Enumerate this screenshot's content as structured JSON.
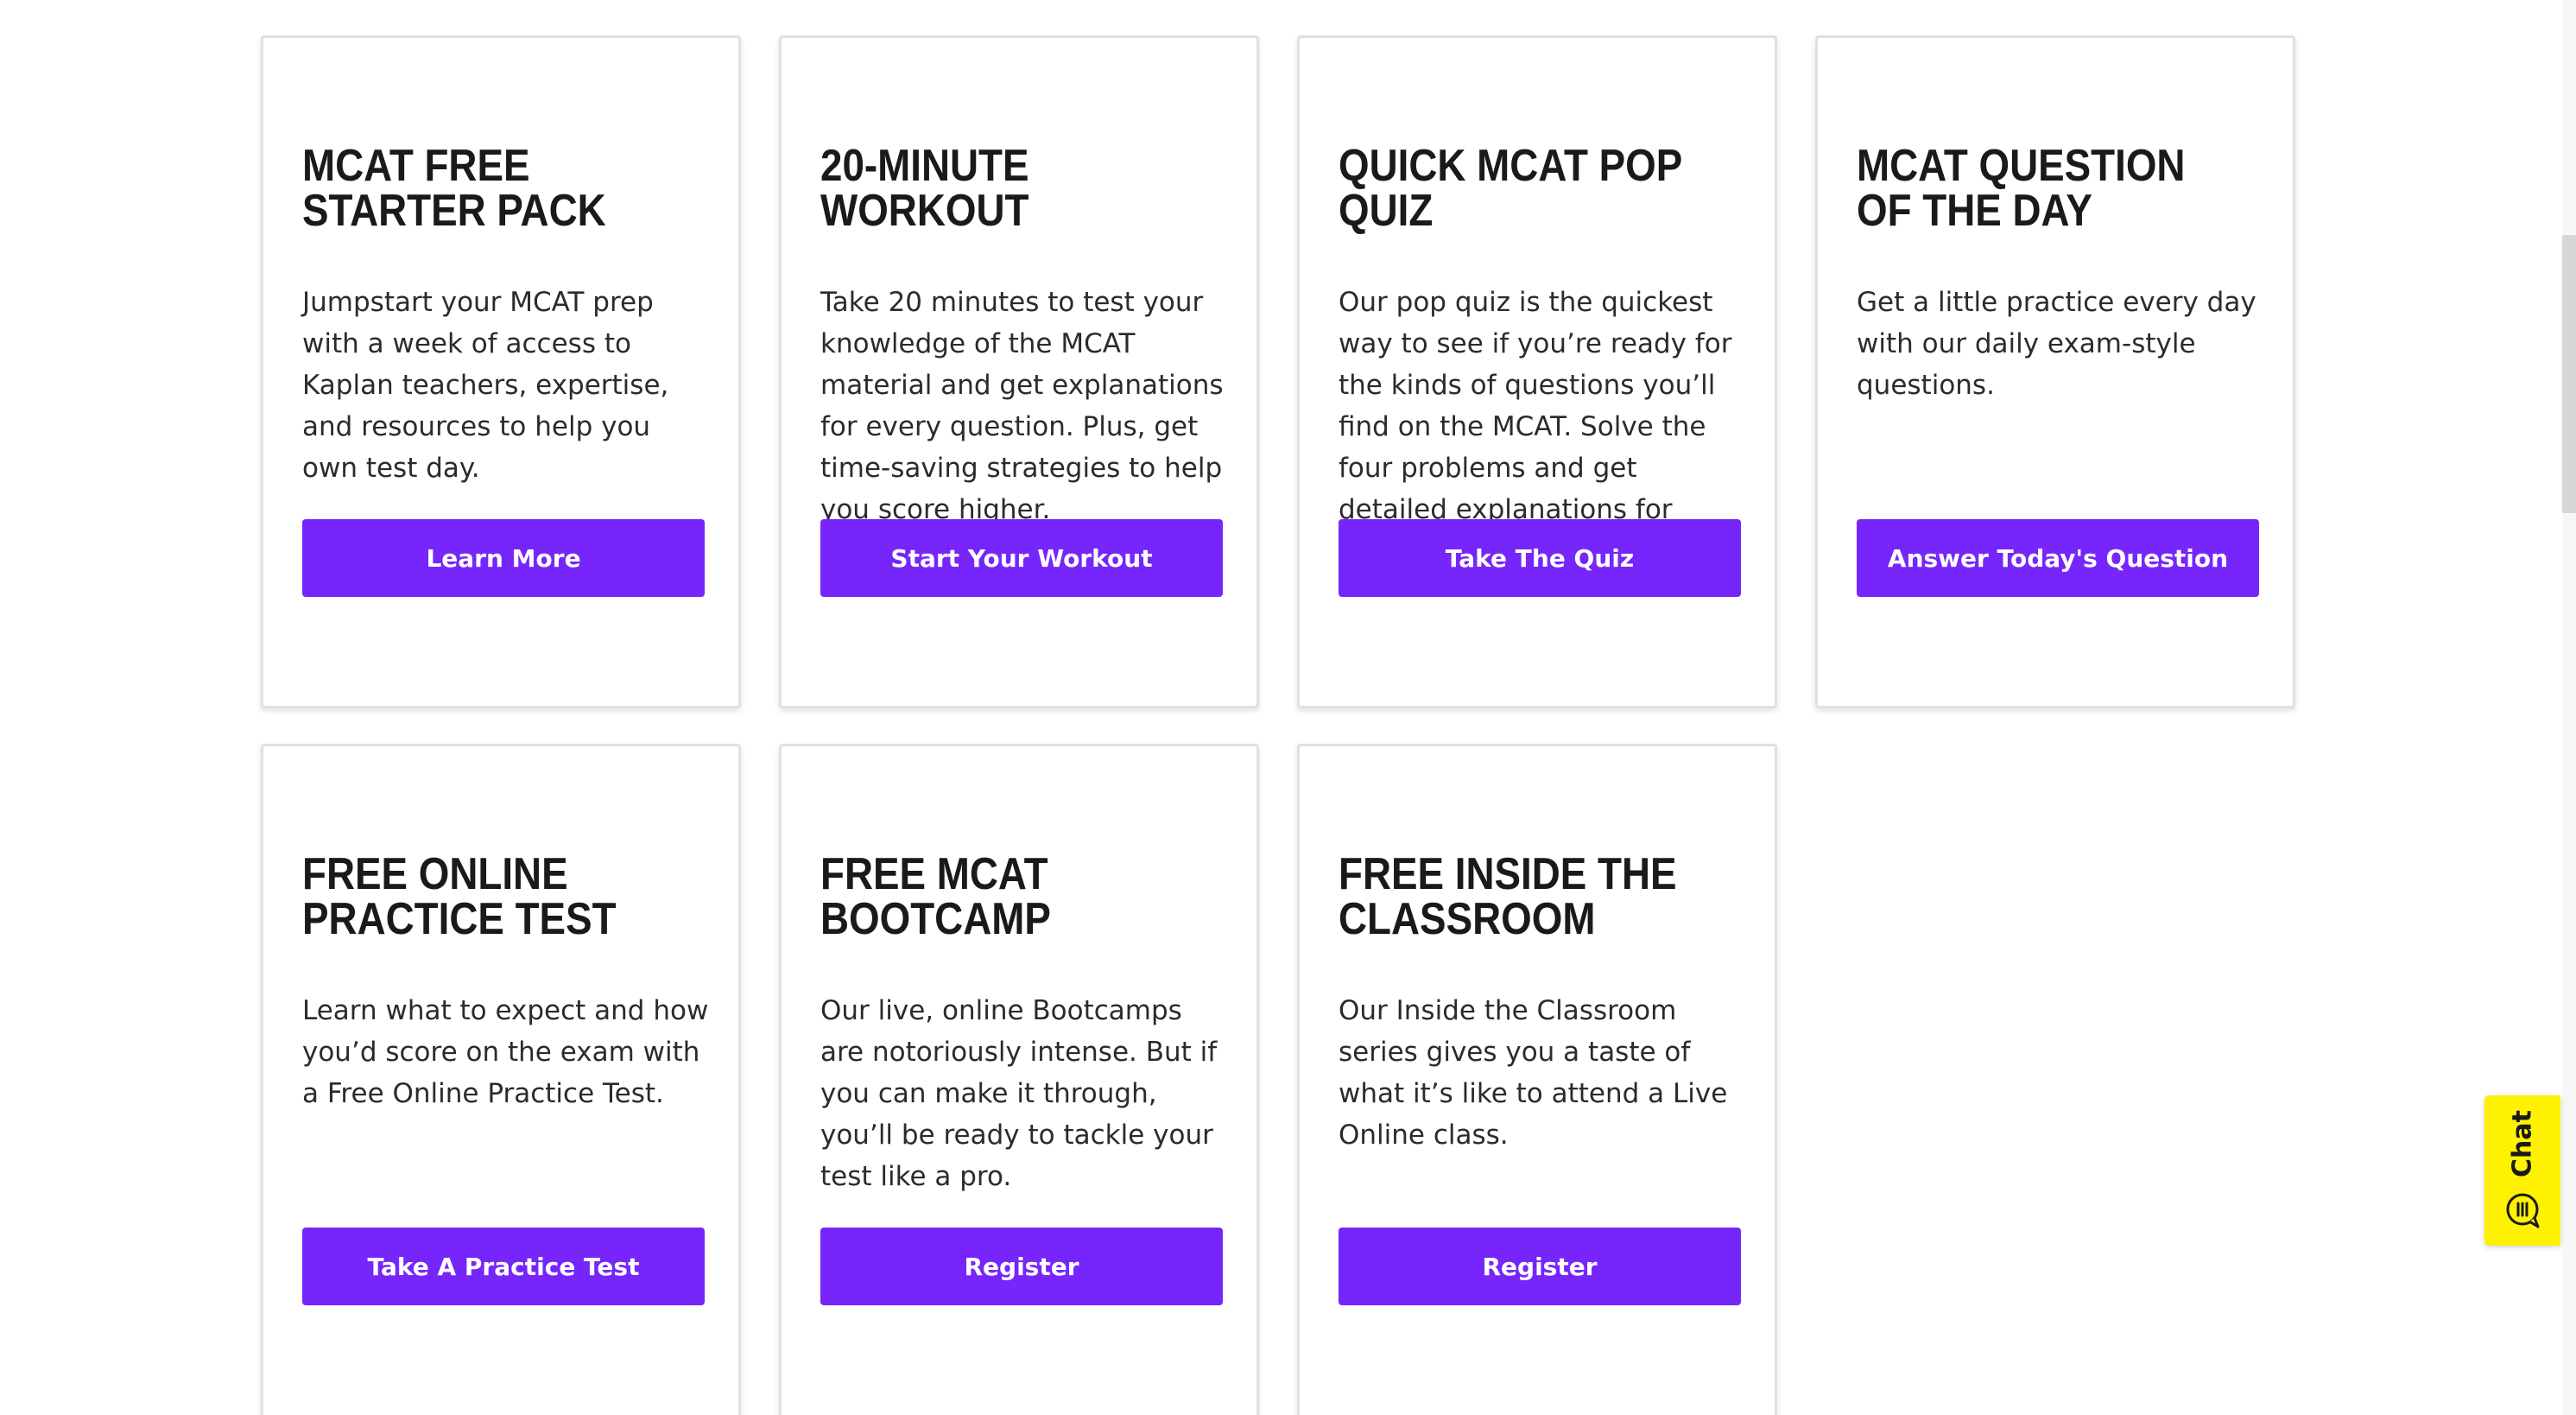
{
  "cards": [
    {
      "title_line1": "MCAT FREE",
      "title_line2": "STARTER PACK",
      "description": "Jumpstart your MCAT prep with a week of access to Kaplan teachers, expertise, and resources to help you own test day.",
      "button_label": "Learn More"
    },
    {
      "title_line1": "20-MINUTE",
      "title_line2": "WORKOUT",
      "description": "Take 20 minutes to test your knowledge of the MCAT material and get explanations for every question. Plus, get time-saving strategies to help you score higher.",
      "button_label": "Start Your Workout"
    },
    {
      "title_line1": "QUICK MCAT POP",
      "title_line2": "QUIZ",
      "description": "Our pop quiz is the quickest way to see if you’re ready for the kinds of questions you’ll find on the MCAT. Solve the four problems and get detailed explanations for each.",
      "button_label": "Take The Quiz"
    },
    {
      "title_line1": "MCAT QUESTION",
      "title_line2": "OF THE DAY",
      "description": "Get a little practice every day with our daily exam-style questions.",
      "button_label": "Answer Today's Question"
    },
    {
      "title_line1": "FREE ONLINE",
      "title_line2": "PRACTICE TEST",
      "description": "Learn what to expect and how you’d score on the exam with a Free Online Practice Test.",
      "button_label": "Take A Practice Test"
    },
    {
      "title_line1": "FREE MCAT",
      "title_line2": "BOOTCAMP",
      "description": "Our live, online Bootcamps are notoriously intense. But if you can make it through, you’ll be ready to tackle your test like a pro.",
      "button_label": "Register"
    },
    {
      "title_line1": "FREE INSIDE THE",
      "title_line2": "CLASSROOM",
      "description": "Our Inside the Classroom series gives you a taste of what it’s like to attend a Live Online class.",
      "button_label": "Register"
    }
  ],
  "chat": {
    "label": "Chat",
    "icon": "chat-bubble-icon"
  },
  "colors": {
    "button": "#7626fa",
    "chat_tab": "#fff200",
    "title_text": "#1a1a1a"
  }
}
